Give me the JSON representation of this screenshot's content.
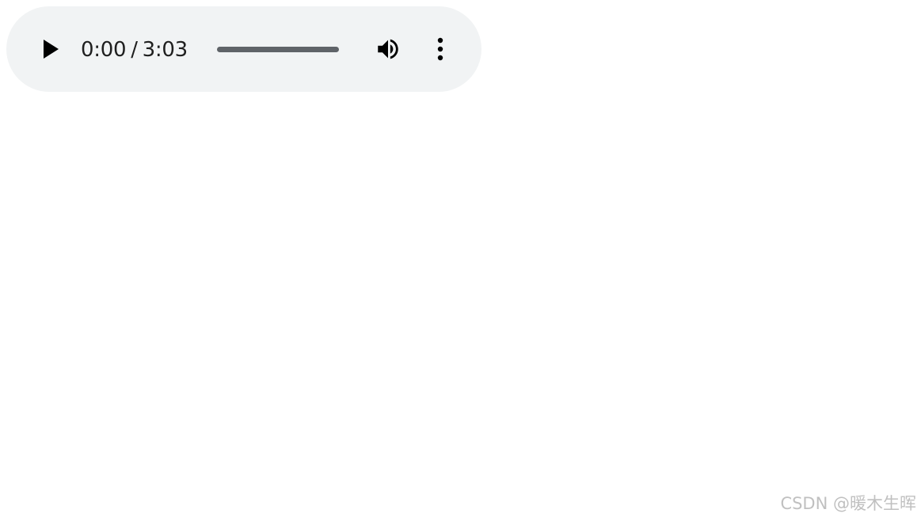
{
  "audio_player": {
    "current_time": "0:00",
    "separator": "/",
    "duration": "3:03",
    "progress_fraction": 0,
    "icons": {
      "play": "play-icon",
      "volume": "volume-icon",
      "more": "more-vertical-icon"
    },
    "colors": {
      "background": "#f1f3f4",
      "track": "#5f6368",
      "icon": "#000000"
    }
  },
  "watermark": {
    "text": "CSDN @暖木生晖"
  }
}
